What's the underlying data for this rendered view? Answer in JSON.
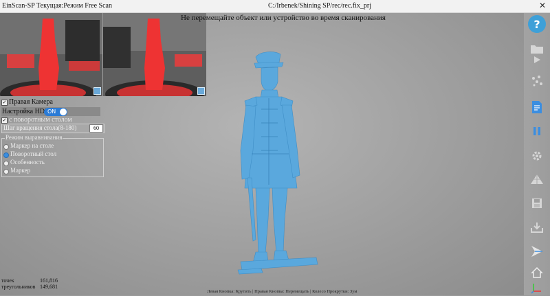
{
  "window": {
    "title": "EinScan-SP Текущая:Режим Free Scan",
    "path": "C:/Irbenek/Shining SP/rec/rec.fix_prj",
    "close_glyph": "✕"
  },
  "viewport": {
    "message": "Не перемещайте объект или устройство во время сканирования"
  },
  "left_panel": {
    "right_camera_label": "Правая Камера",
    "hdr_label": "Настройка HDR",
    "hdr_toggle": "ON",
    "turntable_label": "с поворотным столом",
    "rotation_label": "Шаг вращения стола(8-180)",
    "rotation_value": "60",
    "alignment_title": "Режим выравнивания",
    "alignment_options": [
      "Маркер на столе",
      "Поворотный стол",
      "Особенность",
      "Маркер"
    ],
    "alignment_selected": 1
  },
  "stats": {
    "points_label": "точек",
    "points_value": "161,816",
    "triangles_label": "треугольников",
    "triangles_value": "149,681"
  },
  "status_hint": "Левая Кнопка: Крутить | Правая Кнопка: Перемещать | Колесо Прокрутки: Зум",
  "toolbar": {
    "help_label": "?",
    "icons": [
      "help-icon",
      "folder-icon",
      "play-icon",
      "scatter-points-icon",
      "document-edit-icon",
      "pause-icon",
      "settings-gear-icon",
      "mesh-icon",
      "save-icon",
      "export-icon",
      "measure-icon",
      "home-icon",
      "axis-icon"
    ]
  },
  "colors": {
    "model": "#5aa8dd",
    "accent": "#2b7bd6",
    "help": "#3ea0d8"
  }
}
